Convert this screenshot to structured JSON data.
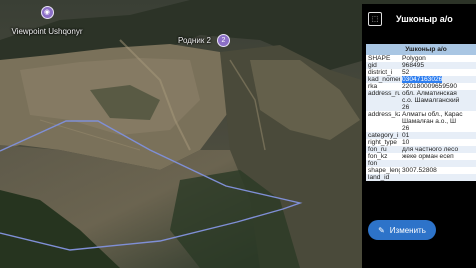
{
  "map": {
    "pois": [
      {
        "label": "Viewpoint Ushqonyr",
        "icon": "camera-pin-icon",
        "color": "#8c6fc7"
      },
      {
        "label": "Родник 2",
        "icon": "spring-pin-icon",
        "color": "#8c6fc7"
      }
    ],
    "polygon_outline_color": "#7f8fd6"
  },
  "panel": {
    "title": "Ушконыр а/о",
    "icon": "layer-icon",
    "table_header": "Ушконыр а/о",
    "attributes": [
      {
        "key": "SHAPE",
        "value": "Polygon"
      },
      {
        "key": "gid",
        "value": "968495"
      },
      {
        "key": "district_i",
        "value": "52"
      },
      {
        "key": "kad_nomer",
        "value": "03047163026",
        "highlighted": true
      },
      {
        "key": "rka",
        "value": "220180009659590"
      },
      {
        "key": "address_ru",
        "value": "обл. Алматинская\nс.о. Шамалганский\n26"
      },
      {
        "key": "address_kz",
        "value": "Алматы обл., Карас\nШамалған а.о., Ш\n26"
      },
      {
        "key": "category_i",
        "value": "01"
      },
      {
        "key": "right_type",
        "value": "10"
      },
      {
        "key": "fon_ru",
        "value": "для частного лесо"
      },
      {
        "key": "fon_kz",
        "value": "жеке орман есеп"
      },
      {
        "key": "fon",
        "value": ""
      },
      {
        "key": "shape_leng",
        "value": "3007.52808"
      },
      {
        "key": "land_id",
        "value": ""
      }
    ],
    "edit_button": {
      "label": "Изменить",
      "icon": "pencil-icon",
      "color": "#2d73c9"
    }
  }
}
